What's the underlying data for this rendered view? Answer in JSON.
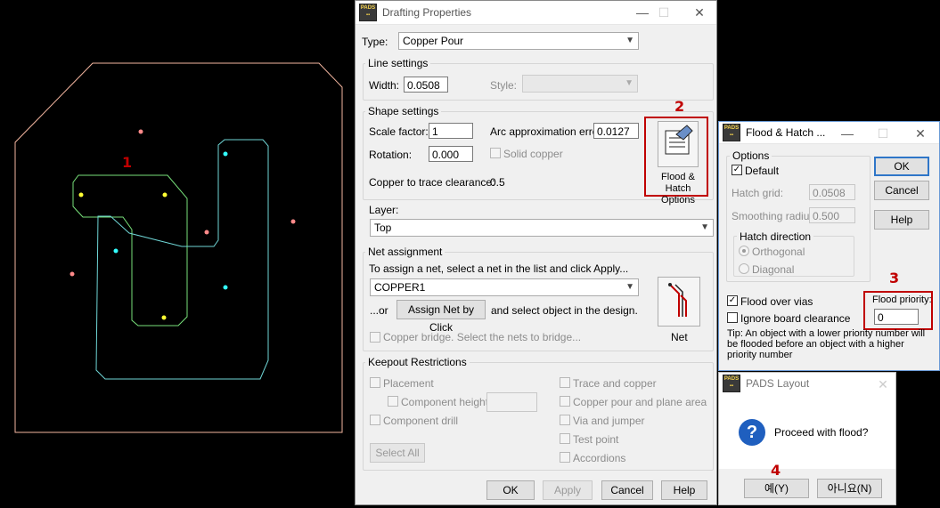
{
  "annotations": {
    "n1": "1",
    "n2": "2",
    "n3": "3",
    "n4": "4"
  },
  "drafting": {
    "title": "Drafting Properties",
    "type_label": "Type:",
    "type_value": "Copper Pour",
    "line_settings": "Line settings",
    "width_label": "Width:",
    "width_value": "0.0508",
    "style_label": "Style:",
    "shape_settings": "Shape settings",
    "scale_label": "Scale factor:",
    "scale_value": "1",
    "arc_label": "Arc approximation error:",
    "arc_value": "0.0127",
    "rotation_label": "Rotation:",
    "rotation_value": "0.000",
    "solid_copper": "Solid copper",
    "clearance_label": "Copper to trace clearance:",
    "clearance_value": "0.5",
    "flood_btn_line1": "Flood & Hatch",
    "flood_btn_line2": "Options",
    "layer_label": "Layer:",
    "layer_value": "Top",
    "net_assignment": "Net assignment",
    "net_instructions": "To assign a net, select a net in the list and click Apply...",
    "net_value": "COPPER1",
    "or_label": "...or",
    "assign_btn": "Assign Net by Click",
    "assign_hint": "and select object in the design.",
    "net_btn": "Net",
    "copper_bridge": "Copper bridge. Select the nets to bridge...",
    "keepout": "Keepout Restrictions",
    "placement": "Placement",
    "component_height": "Component height",
    "component_drill": "Component drill",
    "trace_copper": "Trace and copper",
    "copper_pour_plane": "Copper pour and plane area",
    "via_jumper": "Via and jumper",
    "test_point": "Test point",
    "accordions": "Accordions",
    "select_all": "Select All",
    "ok": "OK",
    "apply": "Apply",
    "cancel": "Cancel",
    "help": "Help"
  },
  "flood": {
    "title": "Flood & Hatch ...",
    "options": "Options",
    "default": "Default",
    "hatch_grid_label": "Hatch grid:",
    "hatch_grid_value": "0.0508",
    "smoothing_label": "Smoothing radius:",
    "smoothing_value": "0.500",
    "hatch_direction": "Hatch direction",
    "orthogonal": "Orthogonal",
    "diagonal": "Diagonal",
    "flood_over_vias": "Flood over vias",
    "ignore_board": "Ignore board clearance",
    "priority_label": "Flood priority:",
    "priority_value": "0",
    "tip": "Tip: An object with a lower priority number will be flooded before an object with a higher priority number",
    "ok": "OK",
    "cancel": "Cancel",
    "help": "Help"
  },
  "pads": {
    "title": "PADS Layout",
    "message": "Proceed with flood?",
    "yes": "예(Y)",
    "no": "아니요(N)"
  },
  "colors": {
    "accent": "#c00000",
    "board": "#f4b6a0",
    "pour": "#77e07a",
    "trace": "#6fd6d6"
  }
}
